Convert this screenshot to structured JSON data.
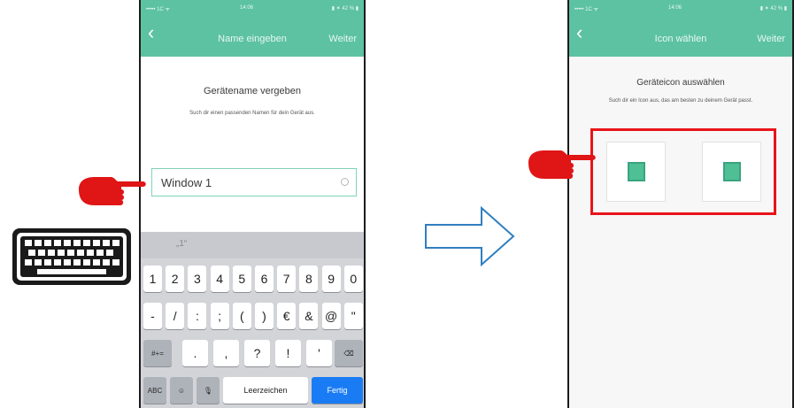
{
  "colors": {
    "teal": "#5cc2a2",
    "red": "#e8141a",
    "blue": "#1a7cf5"
  },
  "screen1": {
    "status": {
      "left": "••••• 1C ᯤ",
      "time": "14:06",
      "right": "▮ ✶ 42 % ▮"
    },
    "nav": {
      "back": "‹",
      "title": "Name eingeben",
      "next": "Weiter"
    },
    "heading": "Gerätename vergeben",
    "subtitle": "Such dir einen passenden Namen für dein Gerät aus.",
    "input_value": "Window 1",
    "suggestion": "„1“",
    "keyboard": {
      "row1": [
        "1",
        "2",
        "3",
        "4",
        "5",
        "6",
        "7",
        "8",
        "9",
        "0"
      ],
      "row2": [
        "-",
        "/",
        ":",
        ";",
        "(",
        ")",
        "€",
        "&",
        "@",
        "\""
      ],
      "row3_mod": "#+=",
      "row3": [
        ".",
        ",",
        "?",
        "!",
        "'"
      ],
      "delete": "⌫",
      "abc": "ABC",
      "emoji": "☺",
      "mic": "🎙",
      "space": "Leerzeichen",
      "done": "Fertig"
    }
  },
  "screen2": {
    "status": {
      "left": "••••• 1C ᯤ",
      "time": "14:06",
      "right": "▮ ✶ 42 % ▮"
    },
    "nav": {
      "back": "‹",
      "title": "Icon wählen",
      "next": "Weiter"
    },
    "heading": "Geräteicon auswählen",
    "subtitle": "Such dir ein Icon aus, das am besten zu deinem Gerät passt."
  },
  "icons": [
    "pointing-hand-icon",
    "keyboard-icon",
    "arrow-right-icon",
    "window-icon",
    "door-icon"
  ]
}
